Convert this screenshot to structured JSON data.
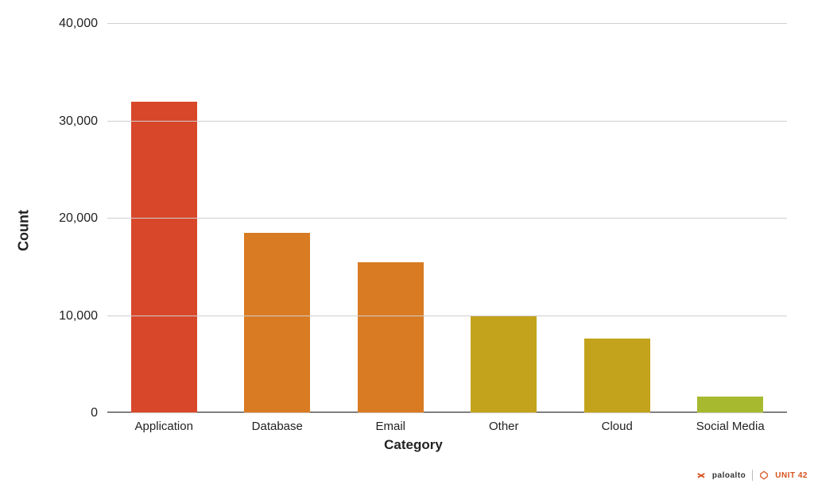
{
  "chart_data": {
    "type": "bar",
    "xlabel": "Category",
    "ylabel": "Count",
    "ylim": [
      0,
      40000
    ],
    "y_ticks": [
      0,
      10000,
      20000,
      30000,
      40000
    ],
    "y_tick_labels": [
      "0",
      "10,000",
      "20,000",
      "30,000",
      "40,000"
    ],
    "categories": [
      "Application",
      "Database",
      "Email",
      "Other",
      "Cloud",
      "Social Media"
    ],
    "values": [
      32000,
      18500,
      15500,
      10000,
      7700,
      1700
    ],
    "colors": [
      "#d8472a",
      "#d97b22",
      "#d97b22",
      "#c3a31b",
      "#c3a31b",
      "#a6b92f"
    ]
  },
  "footer": {
    "brand1": "paloalto",
    "brand2": "UNIT 42"
  }
}
